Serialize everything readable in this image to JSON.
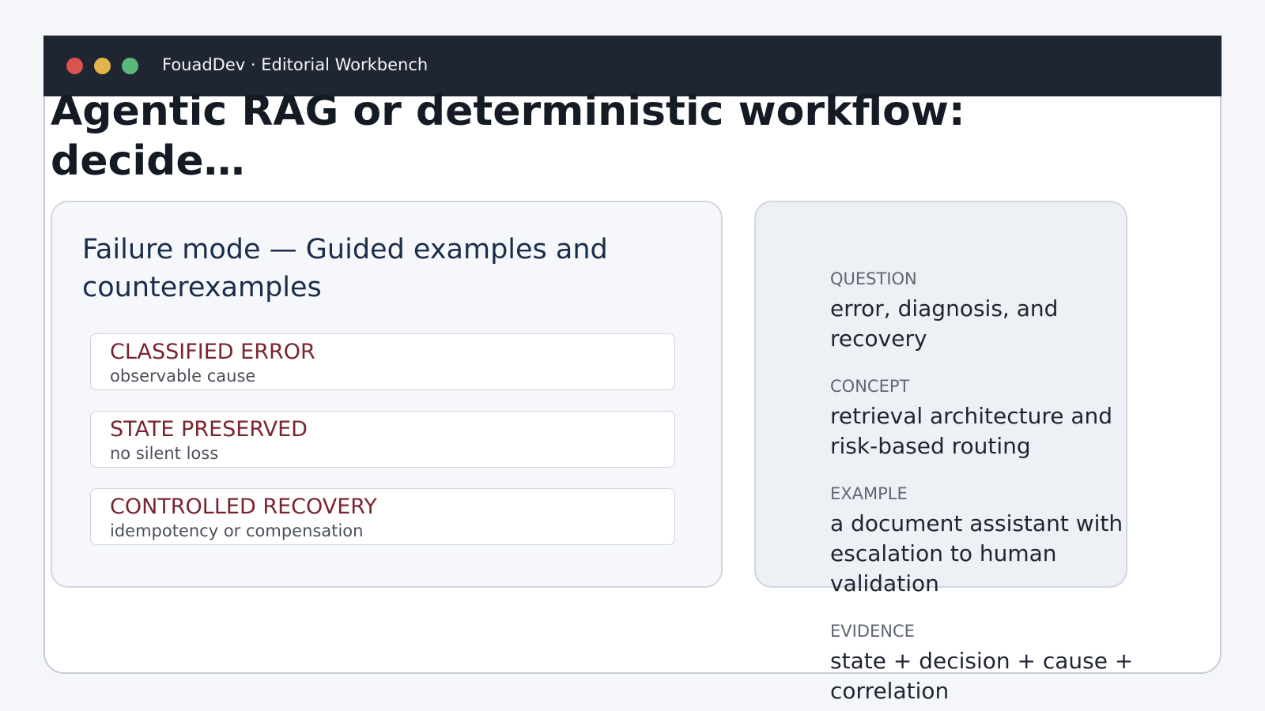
{
  "window": {
    "title": "FouadDev · Editorial Workbench",
    "controls": [
      "close",
      "minimize",
      "maximize"
    ],
    "control_colors": {
      "close": "#d9534f",
      "minimize": "#e4b34b",
      "maximize": "#5bb87a"
    }
  },
  "page": {
    "headline": "Agentic RAG or deterministic workflow: decide…"
  },
  "card": {
    "title": "Failure mode — Guided examples and counterexamples",
    "items": [
      {
        "label": "CLASSIFIED ERROR",
        "sub": "observable cause"
      },
      {
        "label": "STATE PRESERVED",
        "sub": "no silent loss"
      },
      {
        "label": "CONTROLLED RECOVERY",
        "sub": "idempotency or compensation"
      }
    ]
  },
  "side": {
    "fields": [
      {
        "label": "QUESTION",
        "value": "error, diagnosis, and recovery"
      },
      {
        "label": "CONCEPT",
        "value": "retrieval architecture and risk-based routing"
      },
      {
        "label": "EXAMPLE",
        "value": "a document assistant with escalation to human validation"
      },
      {
        "label": "EVIDENCE",
        "value": "state + decision + cause + correlation"
      }
    ]
  },
  "colors": {
    "titlebar": "#1f2531",
    "accent_label": "#7a2430",
    "heading": "#151b24"
  }
}
